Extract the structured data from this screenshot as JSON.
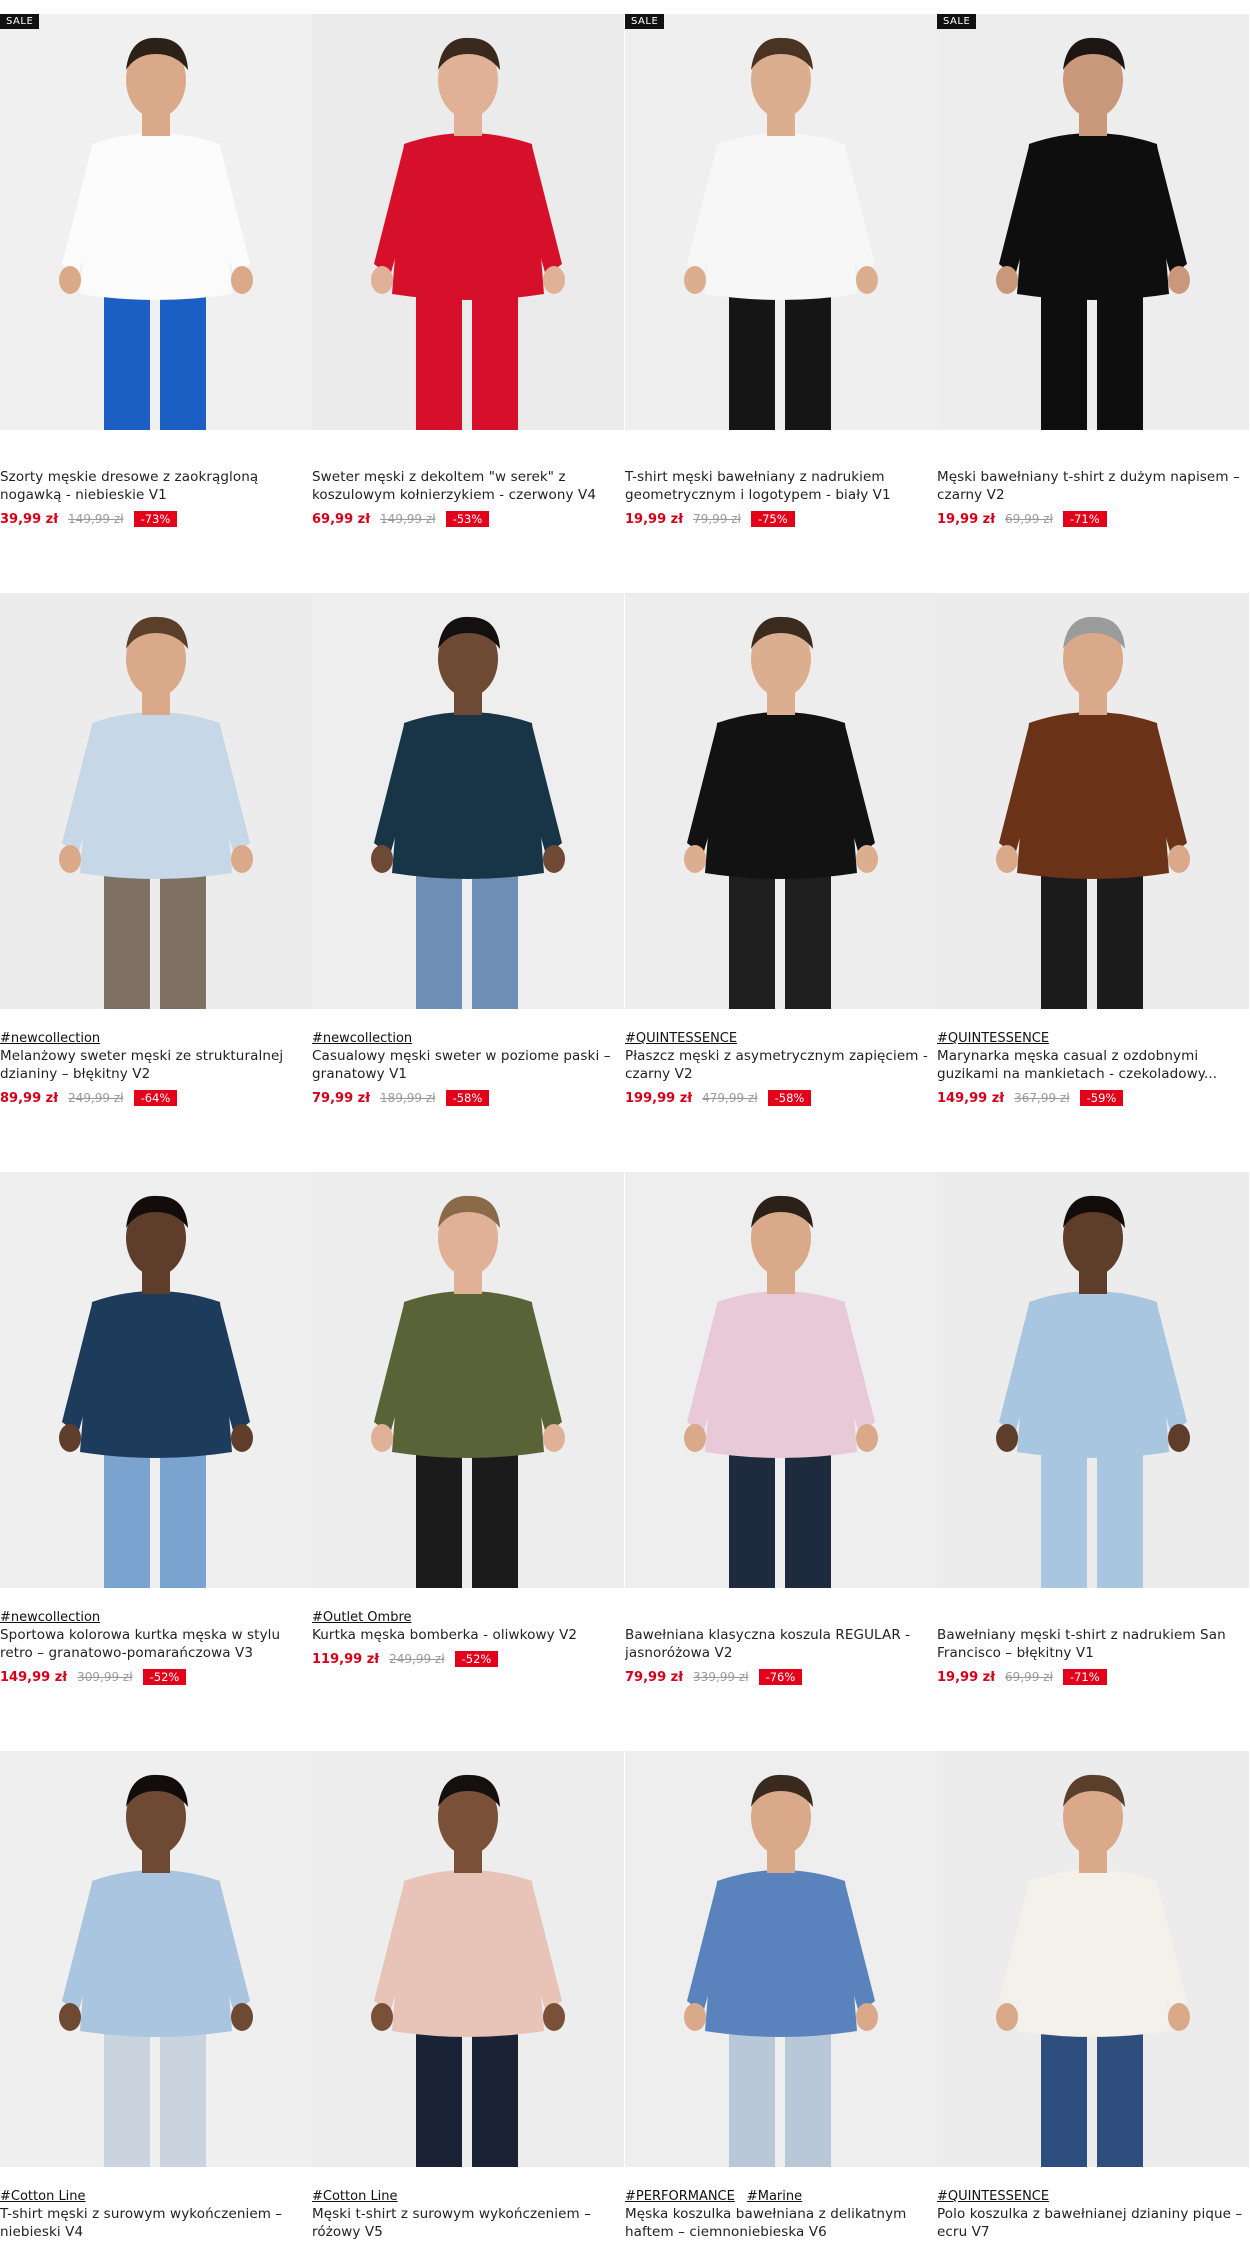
{
  "badge_label": "SALE",
  "colors": {
    "price": "#d4001a",
    "discount_bg": "#e3001b",
    "badge_bg": "#111111"
  },
  "products": [
    {
      "sale": true,
      "tags": [],
      "name": "Szorty męskie dresowe z zaokrągloną nogawką - niebieskie V1",
      "price": "39,99 zł",
      "old_price": "149,99 zł",
      "discount": "-73%"
    },
    {
      "sale": false,
      "tags": [],
      "name": "Sweter męski z dekoltem \"w serek\" z koszulowym kołnierzykiem - czerwony V4",
      "price": "69,99 zł",
      "old_price": "149,99 zł",
      "discount": "-53%"
    },
    {
      "sale": true,
      "tags": [],
      "name": "T-shirt męski bawełniany z nadrukiem geometrycznym i logotypem - biały V1",
      "price": "19,99 zł",
      "old_price": "79,99 zł",
      "discount": "-75%"
    },
    {
      "sale": true,
      "tags": [],
      "name": "Męski bawełniany t-shirt z dużym napisem – czarny V2",
      "price": "19,99 zł",
      "old_price": "69,99 zł",
      "discount": "-71%"
    },
    {
      "sale": false,
      "tags": [
        "#newcollection"
      ],
      "name": "Melanżowy sweter męski ze strukturalnej dzianiny – błękitny V2",
      "price": "89,99 zł",
      "old_price": "249,99 zł",
      "discount": "-64%"
    },
    {
      "sale": false,
      "tags": [
        "#newcollection"
      ],
      "name": "Casualowy męski sweter w poziome paski – granatowy V1",
      "price": "79,99 zł",
      "old_price": "189,99 zł",
      "discount": "-58%"
    },
    {
      "sale": false,
      "tags": [
        "#QUINTESSENCE"
      ],
      "name": "Płaszcz męski z asymetrycznym zapięciem - czarny V2",
      "price": "199,99 zł",
      "old_price": "479,99 zł",
      "discount": "-58%"
    },
    {
      "sale": false,
      "tags": [
        "#QUINTESSENCE"
      ],
      "name": "Marynarka męska casual z ozdobnymi guzikami na mankietach - czekoladowy...",
      "price": "149,99 zł",
      "old_price": "367,99 zł",
      "discount": "-59%"
    },
    {
      "sale": false,
      "tags": [
        "#newcollection"
      ],
      "name": "Sportowa kolorowa kurtka męska w stylu retro – granatowo-pomarańczowa V3",
      "price": "149,99 zł",
      "old_price": "309,99 zł",
      "discount": "-52%"
    },
    {
      "sale": false,
      "tags": [
        "#Outlet Ombre"
      ],
      "name": "Kurtka męska bomberka - oliwkowy V2",
      "price": "119,99 zł",
      "old_price": "249,99 zł",
      "discount": "-52%"
    },
    {
      "sale": false,
      "tags": [],
      "name": "Bawełniana klasyczna koszula REGULAR - jasnoróżowa V2",
      "price": "79,99 zł",
      "old_price": "339,99 zł",
      "discount": "-76%"
    },
    {
      "sale": false,
      "tags": [],
      "name": "Bawełniany męski t-shirt z nadrukiem San Francisco – błękitny V1",
      "price": "19,99 zł",
      "old_price": "69,99 zł",
      "discount": "-71%"
    },
    {
      "sale": false,
      "tags": [
        "#Cotton Line"
      ],
      "name": "T-shirt męski z surowym wykończeniem – niebieski V4",
      "price": "",
      "old_price": "",
      "discount": ""
    },
    {
      "sale": false,
      "tags": [
        "#Cotton Line"
      ],
      "name": "Męski t-shirt z surowym wykończeniem – różowy V5",
      "price": "",
      "old_price": "",
      "discount": ""
    },
    {
      "sale": false,
      "tags": [
        "#PERFORMANCE",
        "#Marine"
      ],
      "name": "Męska koszulka bawełniana z delikatnym haftem – ciemnoniebieska V6",
      "price": "",
      "old_price": "",
      "discount": ""
    },
    {
      "sale": false,
      "tags": [
        "#QUINTESSENCE"
      ],
      "name": "Polo koszulka z bawełnianej dzianiny pique – ecru V7",
      "price": "",
      "old_price": "",
      "discount": ""
    }
  ],
  "photos": [
    {
      "bg": "#f0f0f0",
      "top": "#fbfbfb",
      "bottom": "#1b5fc4",
      "skin": "#d9a98a",
      "hair": "#2b2119",
      "icon": "shorts-model-photo"
    },
    {
      "bg": "#ebebeb",
      "top": "#d6102a",
      "bottom": "#d6102a",
      "skin": "#e0b196",
      "hair": "#3a2a1e",
      "icon": "sweater-model-photo"
    },
    {
      "bg": "#efefef",
      "top": "#f7f7f7",
      "bottom": "#151515",
      "skin": "#dcae90",
      "hair": "#4a3322",
      "icon": "tshirt-model-photo"
    },
    {
      "bg": "#ededed",
      "top": "#0e0e0e",
      "bottom": "#0e0e0e",
      "skin": "#c9977a",
      "hair": "#1d1612",
      "icon": "tshirt-model-photo"
    },
    {
      "bg": "#ececec",
      "top": "#c6d8e8",
      "bottom": "#7e7063",
      "skin": "#d9a98a",
      "hair": "#5a3f2a",
      "icon": "sweater-model-photo"
    },
    {
      "bg": "#eeeeee",
      "top": "#183548",
      "bottom": "#6d8fb5",
      "skin": "#6e4a34",
      "hair": "#151010",
      "icon": "sweater-model-photo"
    },
    {
      "bg": "#ededed",
      "top": "#121212",
      "bottom": "#1e1e1e",
      "skin": "#dcae90",
      "hair": "#3b2a1e",
      "icon": "coat-model-photo"
    },
    {
      "bg": "#ececec",
      "top": "#6a3318",
      "bottom": "#1b1b1b",
      "skin": "#d9a98a",
      "hair": "#9b9b9b",
      "icon": "blazer-model-photo"
    },
    {
      "bg": "#efefef",
      "top": "#1d3c5c",
      "bottom": "#7aa3cf",
      "skin": "#5e3d2a",
      "hair": "#120d0b",
      "icon": "jacket-model-photo"
    },
    {
      "bg": "#ededed",
      "top": "#5a6238",
      "bottom": "#1b1b1b",
      "skin": "#e0b196",
      "hair": "#8a6a48",
      "icon": "jacket-model-photo"
    },
    {
      "bg": "#eeeeee",
      "top": "#e8c9d8",
      "bottom": "#1e2a3e",
      "skin": "#d9a98a",
      "hair": "#2b2119",
      "icon": "shirt-model-photo"
    },
    {
      "bg": "#ececec",
      "top": "#a8c6df",
      "bottom": "#a8c6df",
      "skin": "#5e3d2a",
      "hair": "#120d0b",
      "icon": "tshirt-model-photo"
    },
    {
      "bg": "#efefef",
      "top": "#a9c5df",
      "bottom": "#c9d4de",
      "skin": "#6e4a34",
      "hair": "#120d0b",
      "icon": "tshirt-model-photo"
    },
    {
      "bg": "#ededed",
      "top": "#e8c3b8",
      "bottom": "#1a2235",
      "skin": "#7a5038",
      "hair": "#151010",
      "icon": "tshirt-model-photo"
    },
    {
      "bg": "#eeeeee",
      "top": "#5a83bd",
      "bottom": "#b8c8d8",
      "skin": "#d9a98a",
      "hair": "#3a2a1e",
      "icon": "tshirt-model-photo"
    },
    {
      "bg": "#ececec",
      "top": "#f3f1ea",
      "bottom": "#2e4f7e",
      "skin": "#d9a98a",
      "hair": "#5a3f2a",
      "icon": "polo-model-photo"
    }
  ]
}
